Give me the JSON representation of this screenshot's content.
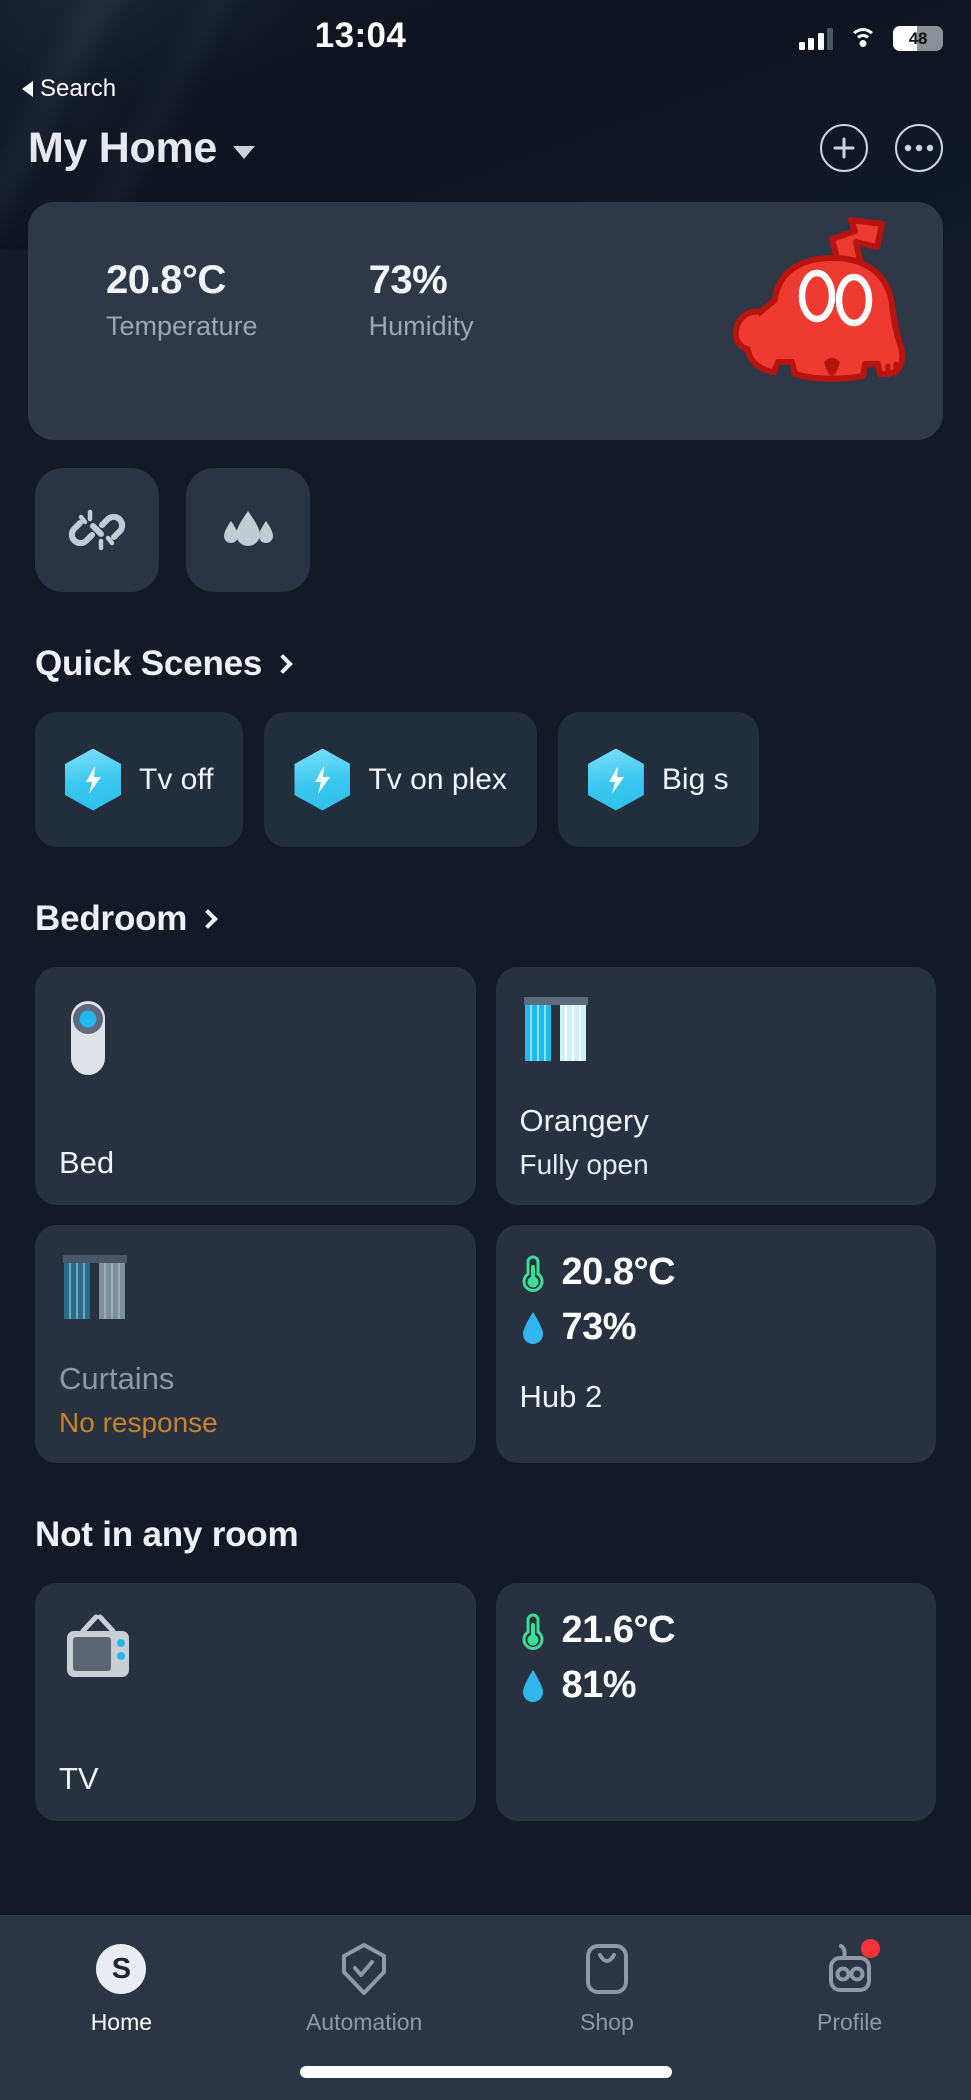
{
  "status_bar": {
    "time": "13:04",
    "battery_level": "48",
    "battery_percent": 48,
    "signal_icon": "cellular-signal-icon",
    "wifi_icon": "wifi-icon",
    "battery_icon": "battery-icon"
  },
  "nav": {
    "back_label": "Search",
    "back_icon": "back-triangle-icon"
  },
  "header": {
    "title": "My Home",
    "dropdown_icon": "chevron-down-icon",
    "add_icon": "plus-circle-icon",
    "more_icon": "more-options-icon"
  },
  "hero": {
    "temperature_value": "20.8°C",
    "temperature_label": "Temperature",
    "humidity_value": "73%",
    "humidity_label": "Humidity",
    "mascot_icon": "red-pig-mascot-icon",
    "mascot_color": "#eb3b33",
    "card_color": "#2e3847"
  },
  "chips": [
    {
      "icon": "broken-link-icon",
      "name": "disconnected-chip"
    },
    {
      "icon": "water-drops-icon",
      "name": "humidity-chip"
    }
  ],
  "quick_scenes": {
    "heading": "Quick Scenes",
    "chevron_icon": "chevron-right-icon",
    "accent_color": "#39c6ef",
    "items": [
      {
        "label": "Tv off",
        "icon": "scene-bolt-icon"
      },
      {
        "label": "Tv on plex",
        "icon": "scene-bolt-icon"
      },
      {
        "label": "Big s",
        "icon": "scene-bolt-icon"
      }
    ]
  },
  "rooms": [
    {
      "name": "Bedroom",
      "chevron_icon": "chevron-right-icon",
      "has_chevron": true,
      "devices": [
        {
          "type": "device",
          "name": "Bed",
          "status": "",
          "icon": "remote-button-icon",
          "offline": false
        },
        {
          "type": "device",
          "name": "Orangery",
          "status": "Fully open",
          "icon": "blinds-open-icon",
          "offline": false
        },
        {
          "type": "device",
          "name": "Curtains",
          "status": "No response",
          "icon": "blinds-offline-icon",
          "offline": true
        },
        {
          "type": "sensor",
          "name": "Hub 2",
          "temperature": "20.8°C",
          "humidity": "73%",
          "temp_icon": "thermometer-icon",
          "humidity_icon": "water-drop-icon",
          "temp_color": "#3ddc97",
          "humidity_color": "#31b6f0"
        }
      ]
    },
    {
      "name": "Not in any room",
      "chevron_icon": "",
      "has_chevron": false,
      "devices": [
        {
          "type": "device",
          "name": "TV",
          "status": "",
          "icon": "retro-tv-icon",
          "offline": false
        },
        {
          "type": "sensor",
          "name": "",
          "temperature": "21.6°C",
          "humidity": "81%",
          "temp_icon": "thermometer-icon",
          "humidity_icon": "water-drop-icon",
          "temp_color": "#3ddc97",
          "humidity_color": "#31b6f0"
        }
      ]
    }
  ],
  "tabbar": {
    "items": [
      {
        "label": "Home",
        "icon": "smartthings-s-icon",
        "active": true,
        "badge": false
      },
      {
        "label": "Automation",
        "icon": "shield-check-icon",
        "active": false,
        "badge": false
      },
      {
        "label": "Shop",
        "icon": "shopping-bag-icon",
        "active": false,
        "badge": false
      },
      {
        "label": "Profile",
        "icon": "robot-head-icon",
        "active": false,
        "badge": true
      }
    ]
  }
}
